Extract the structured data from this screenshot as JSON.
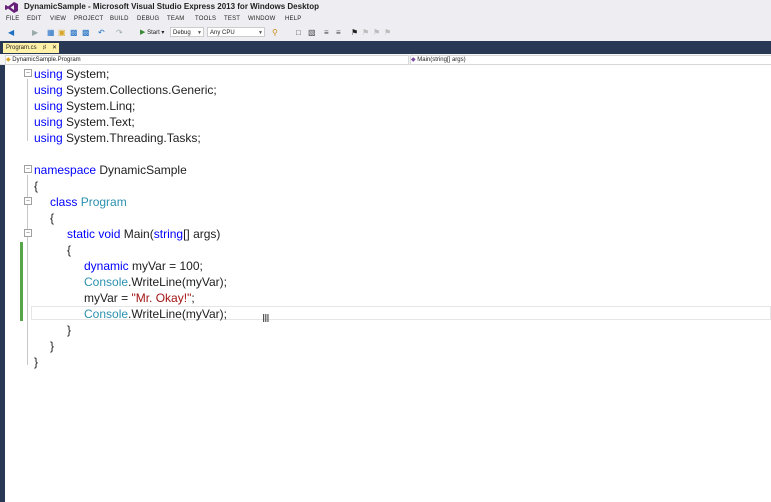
{
  "window": {
    "title": "DynamicSample - Microsoft Visual Studio Express 2013 for Windows Desktop"
  },
  "menu": [
    "FILE",
    "EDIT",
    "VIEW",
    "PROJECT",
    "BUILD",
    "DEBUG",
    "TEAM",
    "TOOLS",
    "TEST",
    "WINDOW",
    "HELP"
  ],
  "toolbar": {
    "start_label": "Start",
    "configuration": "Debug",
    "platform": "Any CPU"
  },
  "tab": {
    "label": "Program.cs"
  },
  "navigation": {
    "type_scope": "DynamicSample.Program",
    "member_scope": "Main(string[] args)"
  },
  "code": {
    "kw_using": "using",
    "using_system": "System;",
    "using_generic": "System.Collections.Generic;",
    "using_linq": "System.Linq;",
    "using_text": "System.Text;",
    "using_tasks": "System.Threading.Tasks;",
    "kw_namespace": "namespace",
    "namespace_name": "DynamicSample",
    "brace_open": "{",
    "brace_close": "}",
    "kw_class": "class",
    "class_name": "Program",
    "kw_static": "static",
    "kw_void": "void",
    "main_name": "Main(",
    "kw_string": "string",
    "main_params": "[] args)",
    "kw_dynamic": "dynamic",
    "decl_rest": "myVar = 100;",
    "console": "Console",
    "writeline_call": ".WriteLine(myVar);",
    "assign_lhs": "myVar = ",
    "string_literal": "\"Mr. Okay!\"",
    "semicolon": ";"
  },
  "colors": {
    "keyword": "#0000ff",
    "type": "#2b91af",
    "string": "#a31515",
    "text": "#1e1e1e",
    "changed_lines": "#57a64a",
    "tab_active": "#fff1a8",
    "chrome_dark": "#293955"
  },
  "icons": [
    "vs-logo-icon",
    "back-icon",
    "forward-icon",
    "new-project-icon",
    "open-icon",
    "save-icon",
    "save-all-icon",
    "undo-icon",
    "redo-icon",
    "start-icon",
    "find-icon",
    "bookmark-icon",
    "pin-icon",
    "close-icon",
    "fold-icon"
  ]
}
